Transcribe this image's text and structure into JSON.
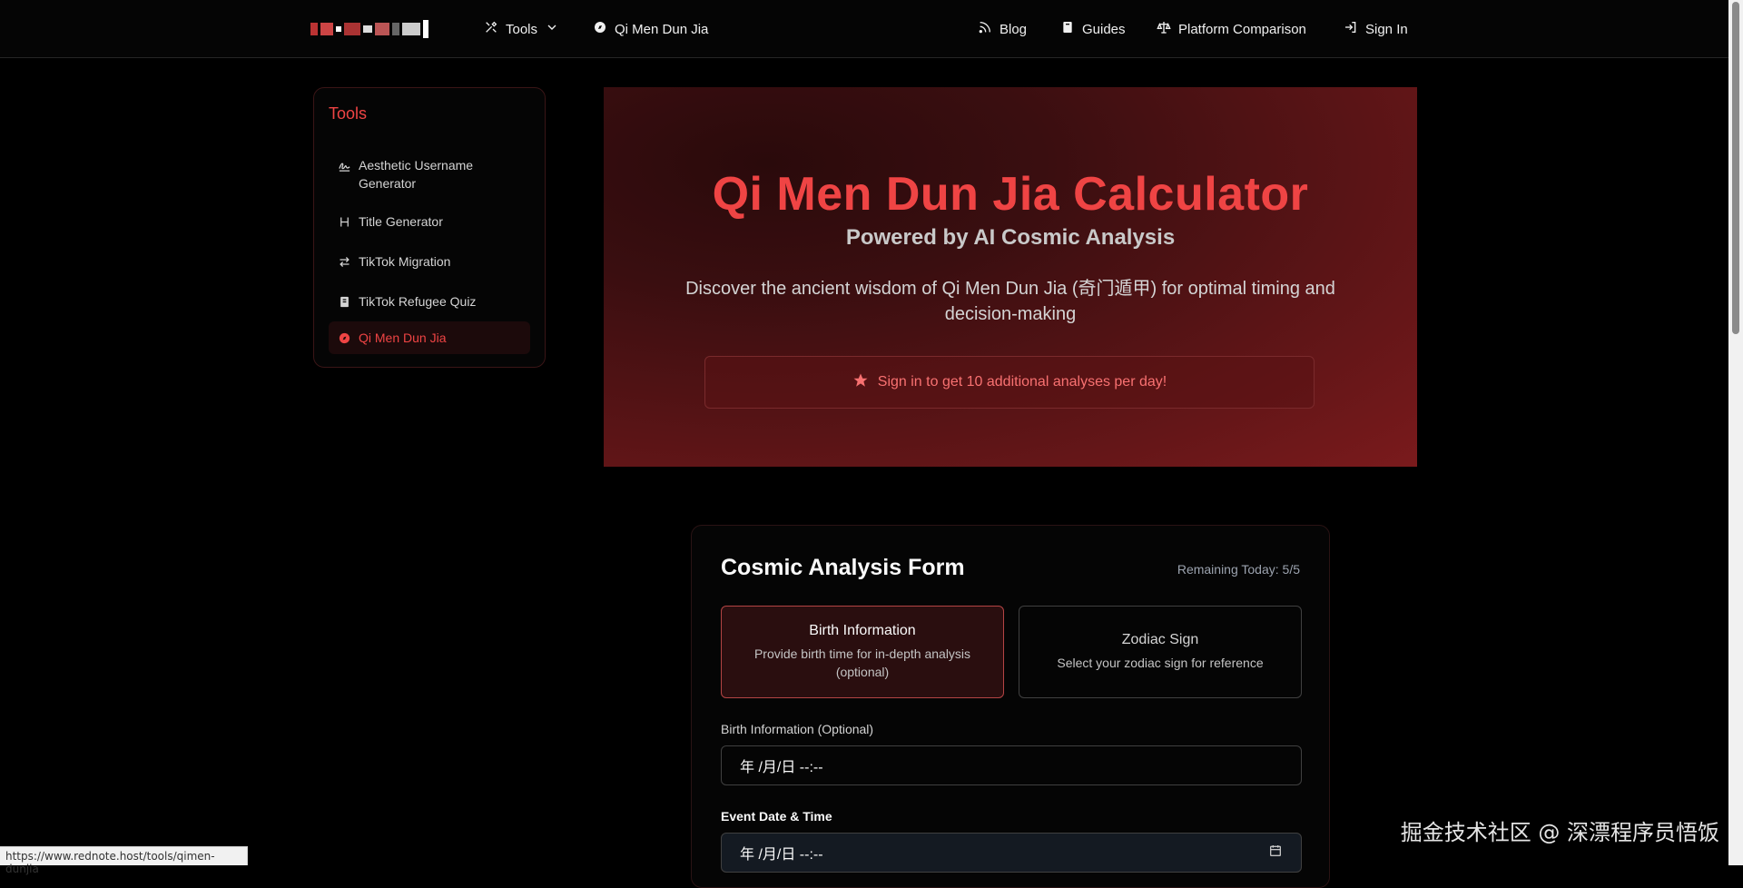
{
  "nav": {
    "tools_label": "Tools",
    "qimen_label": "Qi Men Dun Jia",
    "blog_label": "Blog",
    "guides_label": "Guides",
    "comparison_label": "Platform Comparison",
    "signin_label": "Sign In"
  },
  "sidebar": {
    "title": "Tools",
    "items": [
      {
        "label": "Aesthetic Username Generator",
        "icon": "signature-icon"
      },
      {
        "label": "Title Generator",
        "icon": "heading-icon"
      },
      {
        "label": "TikTok Migration",
        "icon": "arrows-swap-icon"
      },
      {
        "label": "TikTok Refugee Quiz",
        "icon": "book-icon"
      },
      {
        "label": "Qi Men Dun Jia",
        "icon": "compass-icon",
        "active": true
      }
    ]
  },
  "hero": {
    "title": "Qi Men Dun Jia Calculator",
    "subtitle": "Powered by AI Cosmic Analysis",
    "description": "Discover the ancient wisdom of Qi Men Dun Jia (奇门遁甲) for optimal timing and decision-making",
    "banner": "Sign in to get 10 additional analyses per day!"
  },
  "form": {
    "title": "Cosmic Analysis Form",
    "remaining": "Remaining Today: 5/5",
    "choices": [
      {
        "title": "Birth Information",
        "desc": "Provide birth time for in-depth analysis (optional)"
      },
      {
        "title": "Zodiac Sign",
        "desc": "Select your zodiac sign for reference"
      }
    ],
    "birth_label": "Birth Information (Optional)",
    "birth_value": "年 /月/日 --:--",
    "event_label": "Event Date & Time",
    "event_value": "年 /月/日 --:--"
  },
  "status_url": "https://www.rednote.host/tools/qimen-dunjia",
  "watermark": "掘金技术社区 @ 深漂程序员悟饭",
  "colors": {
    "accent": "#ef4444",
    "background": "#000000",
    "hero_gradient_end": "#7a1a1c"
  }
}
